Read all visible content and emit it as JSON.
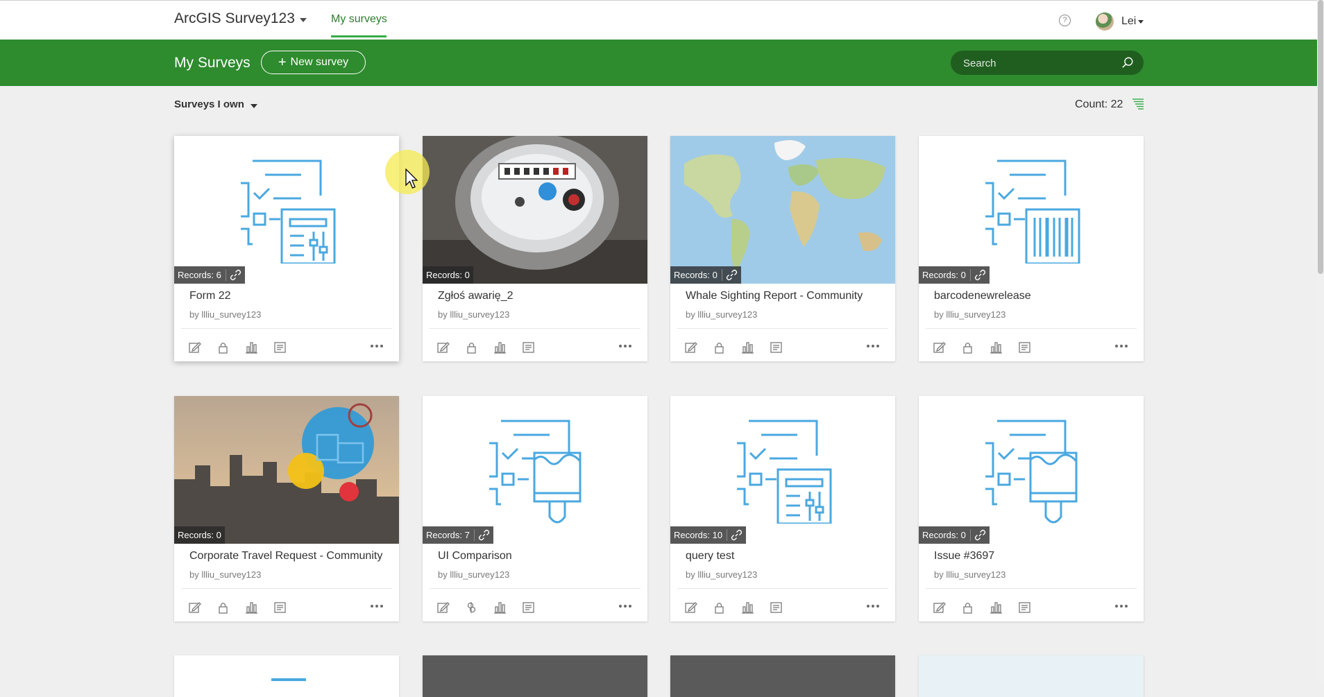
{
  "header": {
    "app_title": "ArcGIS Survey123",
    "nav_tab": "My surveys",
    "user_name": "Lei"
  },
  "toolbar": {
    "page_title": "My Surveys",
    "new_survey_label": "New survey",
    "search_placeholder": "Search"
  },
  "list": {
    "filter_label": "Surveys I own",
    "count_label": "Count: 22"
  },
  "colors": {
    "brand_green": "#2e8b2e",
    "search_bg": "#1f5e1f",
    "nav_accent": "#35ac46",
    "glyph_blue": "#4aa8e0"
  },
  "surveys": [
    {
      "title": "Form 22",
      "owner": "by llliu_survey123",
      "records": "Records: 6",
      "shared": true,
      "thumb": "form-sliders-icon",
      "actions": [
        "edit-icon",
        "lock-icon",
        "chart-icon",
        "data-icon"
      ]
    },
    {
      "title": "Zgłoś awarię_2",
      "owner": "by llliu_survey123",
      "records": "Records: 0",
      "shared": false,
      "thumb": "water-meter-photo",
      "actions": [
        "edit-icon",
        "lock-icon",
        "chart-icon",
        "data-icon"
      ]
    },
    {
      "title": "Whale Sighting Report - Community",
      "owner": "by llliu_survey123",
      "records": "Records: 0",
      "shared": true,
      "thumb": "world-map-photo",
      "actions": [
        "edit-icon",
        "lock-icon",
        "chart-icon",
        "data-icon"
      ]
    },
    {
      "title": "barcodenewrelease",
      "owner": "by llliu_survey123",
      "records": "Records: 0",
      "shared": true,
      "thumb": "form-barcode-icon",
      "actions": [
        "edit-icon",
        "lock-icon",
        "chart-icon",
        "data-icon"
      ]
    },
    {
      "title": "Corporate Travel Request - Community",
      "owner": "by llliu_survey123",
      "records": "Records: 0",
      "shared": false,
      "thumb": "city-travel-photo",
      "actions": [
        "edit-icon",
        "lock-icon",
        "chart-icon",
        "data-icon"
      ]
    },
    {
      "title": "UI Comparison",
      "owner": "by llliu_survey123",
      "records": "Records: 7",
      "shared": true,
      "thumb": "form-brush-icon",
      "actions": [
        "edit-icon",
        "share-icon",
        "chart-icon",
        "data-icon"
      ]
    },
    {
      "title": "query test",
      "owner": "by llliu_survey123",
      "records": "Records: 10",
      "shared": true,
      "thumb": "form-sliders-icon",
      "actions": [
        "edit-icon",
        "lock-icon",
        "chart-icon",
        "data-icon"
      ]
    },
    {
      "title": "Issue #3697",
      "owner": "by llliu_survey123",
      "records": "Records: 0",
      "shared": true,
      "thumb": "form-brush-icon",
      "actions": [
        "edit-icon",
        "lock-icon",
        "chart-icon",
        "data-icon"
      ]
    }
  ]
}
